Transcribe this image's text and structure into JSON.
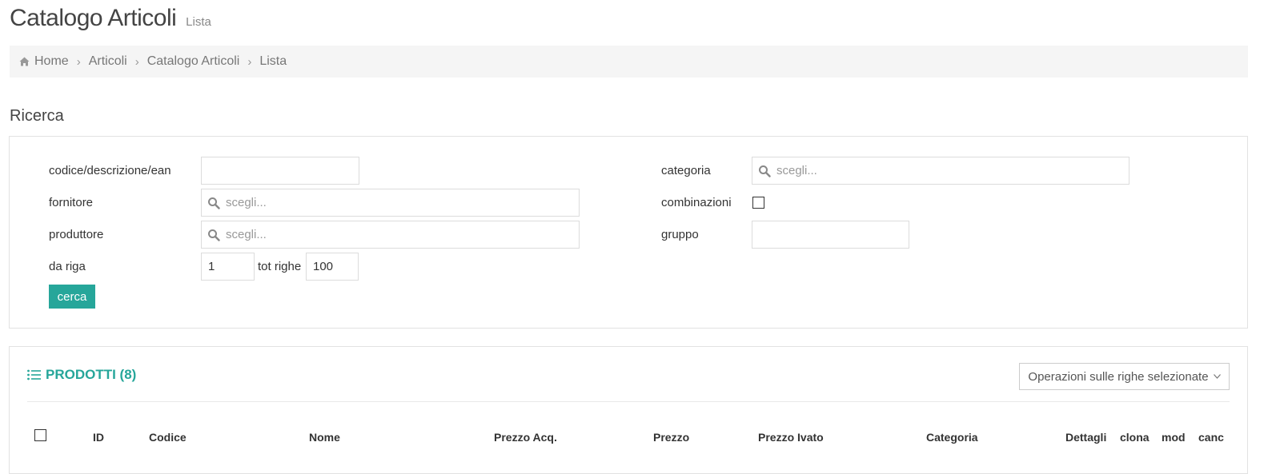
{
  "page": {
    "title": "Catalogo Articoli",
    "subtitle": "Lista"
  },
  "breadcrumb": {
    "items": [
      "Home",
      "Articoli",
      "Catalogo Articoli",
      "Lista"
    ]
  },
  "search": {
    "section_title": "Ricerca",
    "fields": {
      "codice": {
        "label": "codice/descrizione/ean",
        "value": ""
      },
      "fornitore": {
        "label": "fornitore",
        "placeholder": "scegli..."
      },
      "produttore": {
        "label": "produttore",
        "placeholder": "scegli..."
      },
      "da_riga": {
        "label": "da riga",
        "value": "1"
      },
      "tot_righe": {
        "label": "tot righe",
        "value": "100"
      },
      "categoria": {
        "label": "categoria",
        "placeholder": "scegli..."
      },
      "combinazioni": {
        "label": "combinazioni",
        "checked": false
      },
      "gruppo": {
        "label": "gruppo",
        "value": ""
      }
    },
    "submit_label": "cerca"
  },
  "products": {
    "title": "PRODOTTI (8)",
    "operations_label": "Operazioni sulle righe selezionate",
    "columns": [
      "ID",
      "Codice",
      "Nome",
      "Prezzo Acq.",
      "Prezzo",
      "Prezzo Ivato",
      "Categoria",
      "Dettagli",
      "clona",
      "mod",
      "canc"
    ]
  },
  "colors": {
    "accent": "#26a69a",
    "breadcrumb_bg": "#f5f5f5",
    "border": "#e2e2e2"
  },
  "icons": {
    "home": "home-icon",
    "search": "search-icon",
    "list": "list-icon",
    "chevron": "chevron-down-icon"
  }
}
